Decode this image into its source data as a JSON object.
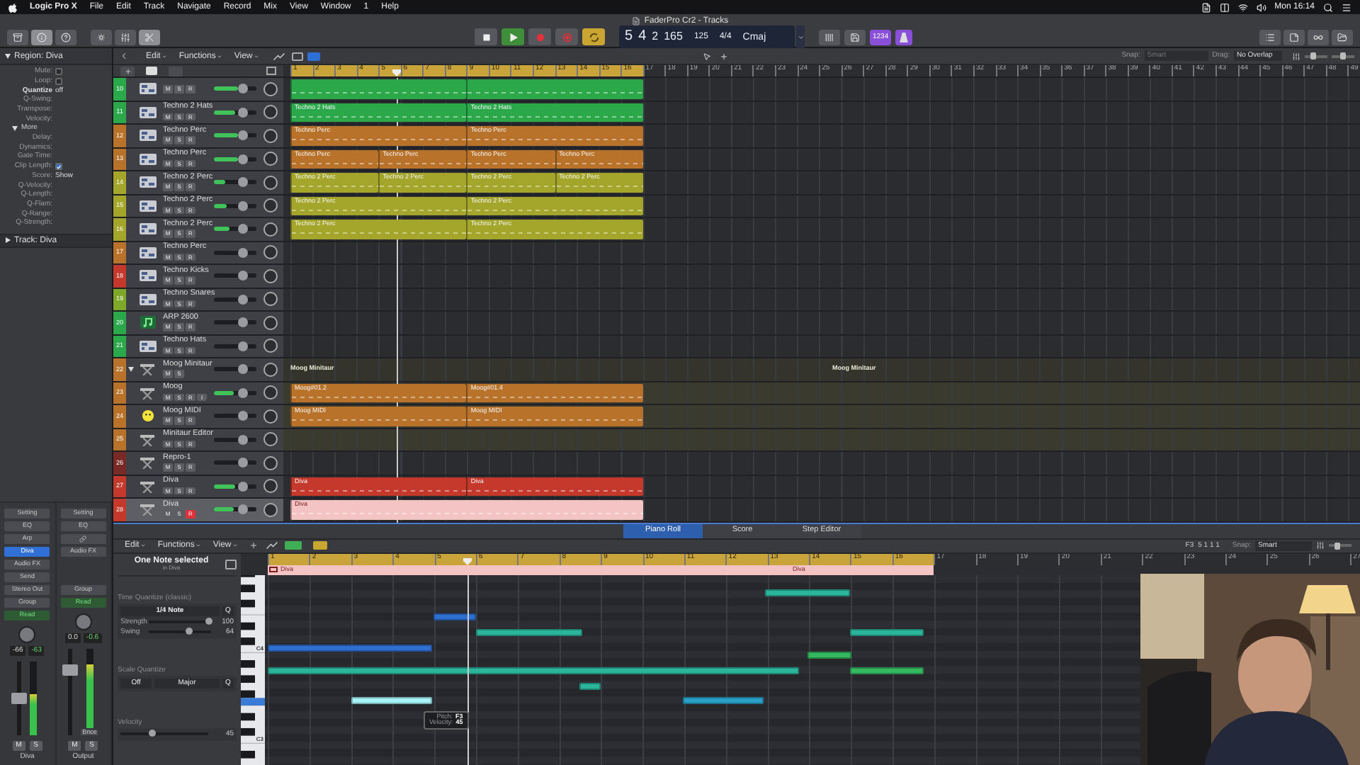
{
  "menu_bar": {
    "app": "Logic Pro X",
    "items": [
      "File",
      "Edit",
      "Track",
      "Navigate",
      "Record",
      "Mix",
      "View",
      "Window",
      "1",
      "Help"
    ],
    "clock": "Mon 16:14"
  },
  "window": {
    "title": "FaderPro Cr2 - Tracks"
  },
  "transport": {
    "buttons": [
      {
        "kind": "stop",
        "on": false
      },
      {
        "kind": "play",
        "on": true
      },
      {
        "kind": "record",
        "on": false
      },
      {
        "kind": "capture",
        "on": false
      },
      {
        "kind": "cycle",
        "on": true
      }
    ],
    "lcd": {
      "bar": "5",
      "beat": "4",
      "div": "2",
      "tick": "165",
      "tempo": "125",
      "signature": "4/4",
      "key": "Cmaj"
    },
    "count_in": {
      "label": "1234",
      "on": true
    },
    "metronome": {
      "on": true
    }
  },
  "inspector": {
    "region": {
      "title": "Region: Diva",
      "expanded": true
    },
    "params": [
      {
        "kind": "checkbox",
        "label": "Mute:",
        "checked": false
      },
      {
        "kind": "checkbox",
        "label": "Loop:",
        "checked": false
      },
      {
        "kind": "value",
        "label": "Quantize",
        "value": "off"
      },
      {
        "kind": "plain",
        "label": "Q-Swing:"
      },
      {
        "kind": "plain",
        "label": "Transpose:"
      },
      {
        "kind": "plain",
        "label": "Velocity:"
      },
      {
        "kind": "section",
        "label": "More",
        "expanded": true
      },
      {
        "kind": "plain",
        "label": "Delay:"
      },
      {
        "kind": "plain",
        "label": "Dynamics:"
      },
      {
        "kind": "plain",
        "label": "Gate Time:"
      },
      {
        "kind": "checkbox",
        "label": "Clip Length:",
        "checked": true
      },
      {
        "kind": "value",
        "label": "Score:",
        "value": "Show"
      },
      {
        "kind": "plain",
        "label": "Q-Velocity:"
      },
      {
        "kind": "plain",
        "label": "Q-Length:"
      },
      {
        "kind": "plain",
        "label": "Q-Flam:"
      },
      {
        "kind": "plain",
        "label": "Q-Range:"
      },
      {
        "kind": "plain",
        "label": "Q-Strength:"
      }
    ],
    "track": {
      "title": "Track: Diva",
      "expanded": false
    },
    "strips": [
      {
        "name": "Diva",
        "slots": [
          {
            "kind": "button",
            "label": "Setting"
          },
          {
            "kind": "button",
            "label": "EQ"
          },
          {
            "kind": "button",
            "label": "Arp"
          },
          {
            "kind": "plugin",
            "label": "Diva"
          },
          {
            "kind": "button",
            "label": "Audio FX"
          },
          {
            "kind": "button",
            "label": "Send"
          },
          {
            "kind": "button",
            "label": "Stereo Out"
          },
          {
            "kind": "button",
            "label": "Group"
          },
          {
            "kind": "automation",
            "label": "Read"
          }
        ],
        "values": [
          "-66",
          "-63"
        ],
        "fader": {
          "level": 0.5
        },
        "meter": {
          "level": 0.55
        },
        "buttons": [
          "M",
          "S"
        ]
      },
      {
        "name": "Output",
        "slots": [
          {
            "kind": "button",
            "label": "Setting"
          },
          {
            "kind": "button",
            "label": "EQ"
          },
          {
            "kind": "link"
          },
          {
            "kind": "button",
            "label": "Audio FX"
          },
          {
            "kind": "empty"
          },
          {
            "kind": "empty"
          },
          {
            "kind": "button",
            "label": "Group"
          },
          {
            "kind": "automation",
            "label": "Read"
          }
        ],
        "values": [
          "0.0",
          "-0.6"
        ],
        "fader": {
          "level": 0.75
        },
        "meter": {
          "level": 0.8
        },
        "bounce": "Bnce",
        "buttons": [
          "M",
          "S"
        ]
      }
    ]
  },
  "tracks_toolbar": {
    "menus": [
      "Edit",
      "Functions",
      "View"
    ],
    "snap_label": "Snap:",
    "snap_value": "Smart",
    "drag_label": "Drag:",
    "drag_value": "No Overlap",
    "zoom_sliders": [
      {
        "level": 0.4
      },
      {
        "level": 0.5
      }
    ]
  },
  "ruler": [
    {
      "label": "1",
      "cycle": true
    },
    {
      "label": "2",
      "cycle": true
    },
    {
      "label": "3",
      "cycle": true
    },
    {
      "label": "4",
      "cycle": true
    },
    {
      "label": "5",
      "cycle": true
    },
    {
      "label": "6",
      "cycle": true
    },
    {
      "label": "7",
      "cycle": true
    },
    {
      "label": "8",
      "cycle": true
    },
    {
      "label": "9",
      "cycle": true
    },
    {
      "label": "10",
      "cycle": true
    },
    {
      "label": "11",
      "cycle": true
    },
    {
      "label": "12",
      "cycle": true
    },
    {
      "label": "13",
      "cycle": true
    },
    {
      "label": "14",
      "cycle": true
    },
    {
      "label": "15",
      "cycle": true
    },
    {
      "label": "16",
      "cycle": true
    },
    {
      "label": "17",
      "cycle": false
    },
    {
      "label": "18",
      "cycle": false
    },
    {
      "label": "19",
      "cycle": false
    },
    {
      "label": "20",
      "cycle": false
    },
    {
      "label": "21",
      "cycle": false
    },
    {
      "label": "22",
      "cycle": false
    },
    {
      "label": "23",
      "cycle": false
    },
    {
      "label": "24",
      "cycle": false
    },
    {
      "label": "25",
      "cycle": false
    },
    {
      "label": "26",
      "cycle": false
    },
    {
      "label": "27",
      "cycle": false
    },
    {
      "label": "28",
      "cycle": false
    },
    {
      "label": "29",
      "cycle": false
    },
    {
      "label": "30",
      "cycle": false
    },
    {
      "label": "31",
      "cycle": false
    },
    {
      "label": "32",
      "cycle": false
    },
    {
      "label": "33",
      "cycle": false
    },
    {
      "label": "34",
      "cycle": false
    },
    {
      "label": "35",
      "cycle": false
    },
    {
      "label": "36",
      "cycle": false
    },
    {
      "label": "37",
      "cycle": false
    },
    {
      "label": "38",
      "cycle": false
    },
    {
      "label": "39",
      "cycle": false
    },
    {
      "label": "40",
      "cycle": false
    },
    {
      "label": "41",
      "cycle": false
    },
    {
      "label": "42",
      "cycle": false
    },
    {
      "label": "43",
      "cycle": false
    },
    {
      "label": "44",
      "cycle": false
    },
    {
      "label": "45",
      "cycle": false
    },
    {
      "label": "46",
      "cycle": false
    },
    {
      "label": "47",
      "cycle": false
    },
    {
      "label": "48",
      "cycle": false
    },
    {
      "label": "49",
      "cycle": false
    }
  ],
  "tracks": [
    {
      "kind": "drum",
      "number": "10",
      "color": "#2aa84a",
      "buttons": [
        "M",
        "S",
        "R"
      ],
      "armed": false,
      "level": 0.55,
      "selected": false,
      "regions": [
        {
          "selected": false
        },
        {
          "selected": false
        }
      ]
    },
    {
      "kind": "drum",
      "number": "11",
      "name": "Techno 2 Hats",
      "color": "#2aa84a",
      "buttons": [
        "M",
        "S",
        "R"
      ],
      "armed": false,
      "level": 0.5,
      "selected": false,
      "regions": [
        {
          "name": "Techno 2 Hats",
          "selected": false
        },
        {
          "name": "Techno 2 Hats",
          "selected": false
        }
      ]
    },
    {
      "kind": "drum",
      "number": "12",
      "name": "Techno Perc",
      "color": "#b8722a",
      "buttons": [
        "M",
        "S",
        "R"
      ],
      "armed": false,
      "level": 0.55,
      "selected": false,
      "regions": [
        {
          "name": "Techno Perc",
          "selected": false
        },
        {
          "name": "Techno Perc",
          "selected": false
        }
      ]
    },
    {
      "kind": "drum",
      "number": "13",
      "name": "Techno Perc",
      "color": "#b8722a",
      "buttons": [
        "M",
        "S",
        "R"
      ],
      "armed": false,
      "level": 0.55,
      "selected": false,
      "regions": [
        {
          "name": "Techno Perc",
          "selected": false
        },
        {
          "name": "Techno Perc",
          "selected": false
        },
        {
          "name": "Techno Perc",
          "selected": false
        },
        {
          "name": "Techno Perc",
          "selected": false
        }
      ]
    },
    {
      "kind": "drum",
      "number": "14",
      "name": "Techno 2 Perc",
      "color": "#a3a62a",
      "buttons": [
        "M",
        "S",
        "R"
      ],
      "armed": false,
      "level": 0.25,
      "selected": false,
      "regions": [
        {
          "name": "Techno 2 Perc",
          "selected": false
        },
        {
          "name": "Techno 2 Perc",
          "selected": false
        },
        {
          "name": "Techno 2 Perc",
          "selected": false
        },
        {
          "name": "Techno 2 Perc",
          "selected": false
        }
      ]
    },
    {
      "kind": "drum",
      "number": "15",
      "name": "Techno 2 Perc",
      "color": "#a3a62a",
      "buttons": [
        "M",
        "S",
        "R"
      ],
      "armed": false,
      "level": 0.3,
      "selected": false,
      "regions": [
        {
          "name": "Techno 2 Perc",
          "selected": false
        },
        {
          "name": "Techno 2 Perc",
          "selected": false
        }
      ]
    },
    {
      "kind": "drum",
      "number": "16",
      "name": "Techno 2 Perc",
      "color": "#a3a62a",
      "buttons": [
        "M",
        "S",
        "R"
      ],
      "armed": false,
      "level": 0.35,
      "selected": false,
      "regions": [
        {
          "name": "Techno 2 Perc",
          "selected": false
        },
        {
          "name": "Techno 2 Perc",
          "selected": false
        }
      ]
    },
    {
      "kind": "drum",
      "number": "17",
      "name": "Techno Perc",
      "color": "#b8722a",
      "buttons": [
        "M",
        "S",
        "R"
      ],
      "armed": false,
      "level": 0,
      "selected": false
    },
    {
      "kind": "drum",
      "number": "18",
      "name": "Techno Kicks",
      "color": "#c4392b",
      "buttons": [
        "M",
        "S",
        "R"
      ],
      "armed": false,
      "level": 0,
      "selected": false
    },
    {
      "kind": "drum",
      "number": "19",
      "name": "Techno Snares",
      "color": "#7ea82a",
      "buttons": [
        "M",
        "S",
        "R"
      ],
      "armed": false,
      "level": 0,
      "selected": false
    },
    {
      "kind": "note",
      "number": "20",
      "name": "ARP 2600",
      "color": "#2aa84a",
      "buttons": [
        "M",
        "S",
        "R"
      ],
      "armed": false,
      "level": 0,
      "selected": false
    },
    {
      "kind": "drum",
      "number": "21",
      "name": "Techno Hats",
      "color": "#2aa84a",
      "buttons": [
        "M",
        "S",
        "R"
      ],
      "armed": false,
      "level": 0,
      "selected": false
    },
    {
      "kind": "synth",
      "number": "22",
      "name": "Moog Minitaur",
      "color": "#b8722a",
      "buttons": [
        "M",
        "S"
      ],
      "level": 0,
      "selected": false,
      "expanded": true,
      "lane_labels": [
        {
          "text": "Moog Minitaur"
        },
        {
          "text": "Moog Minitaur"
        }
      ],
      "children": [
        {
          "kind": "synth",
          "number": "23",
          "name": "Moog",
          "color": "#b8722a",
          "buttons": [
            "M",
            "S",
            "R",
            "I"
          ],
          "armed": false,
          "level": 0.45,
          "selected": false,
          "regions": [
            {
              "name": "Moog#01.2",
              "selected": false
            },
            {
              "name": "Moog#01.4",
              "selected": false
            }
          ]
        },
        {
          "kind": "smiley",
          "number": "24",
          "name": "Moog MIDI",
          "color": "#b8722a",
          "buttons": [
            "M",
            "S",
            "R"
          ],
          "armed": false,
          "level": 0,
          "selected": false,
          "regions": [
            {
              "name": "Moog MIDI",
              "selected": false
            },
            {
              "name": "Moog MIDI",
              "selected": false
            }
          ]
        },
        {
          "kind": "synth",
          "number": "25",
          "name": "Minitaur Editor",
          "color": "#b8722a",
          "buttons": [
            "M",
            "S",
            "R"
          ],
          "armed": false,
          "level": 0,
          "selected": false
        }
      ]
    },
    {
      "kind": "synth",
      "number": "26",
      "name": "Repro-1",
      "color": "#7a2a26",
      "buttons": [
        "M",
        "S",
        "R"
      ],
      "armed": false,
      "level": 0,
      "selected": false
    },
    {
      "kind": "synth",
      "number": "27",
      "name": "Diva",
      "color": "#c4392b",
      "buttons": [
        "M",
        "S",
        "R"
      ],
      "armed": false,
      "level": 0.5,
      "selected": false,
      "regions": [
        {
          "name": "Diva",
          "selected": false
        },
        {
          "name": "Diva",
          "selected": false
        }
      ]
    },
    {
      "kind": "synth",
      "number": "28",
      "name": "Diva",
      "color": "#c4392b",
      "buttons": [
        "M",
        "S",
        "R"
      ],
      "armed": true,
      "level": 0.45,
      "selected": true,
      "regions": [
        {
          "name": "Diva",
          "selected": true
        }
      ]
    }
  ],
  "editor": {
    "tabs": [
      {
        "label": "Piano Roll",
        "selected": true
      },
      {
        "label": "Score",
        "selected": false
      },
      {
        "label": "Step Editor",
        "selected": false
      }
    ],
    "menus": [
      "Edit",
      "Functions",
      "View"
    ],
    "pitch": "F3",
    "position": "5 1 1 1",
    "snap_label": "Snap:",
    "snap_value": "Smart",
    "zoom": {
      "level": 0.4
    },
    "selection": "One Note selected",
    "selection_region": "in Diva",
    "time_quantize": {
      "title": "Time Quantize (classic)",
      "value": "1/4 Note",
      "q": "Q",
      "strength": {
        "label": "Strength",
        "value": "100",
        "level": 0.95
      },
      "swing": {
        "label": "Swing",
        "value": "64",
        "level": 0.64
      }
    },
    "scale_quantize": {
      "title": "Scale Quantize",
      "mode": "Off",
      "scale": "Major",
      "q": "Q"
    },
    "velocity": {
      "label": "Velocity",
      "value": "45",
      "level": 0.35
    },
    "key_labels": [
      "C4",
      "C3"
    ],
    "ruler": [
      {
        "label": "1",
        "cycle": true
      },
      {
        "label": "2",
        "cycle": true
      },
      {
        "label": "3",
        "cycle": true
      },
      {
        "label": "4",
        "cycle": true
      },
      {
        "label": "5",
        "cycle": true
      },
      {
        "label": "6",
        "cycle": true
      },
      {
        "label": "7",
        "cycle": true
      },
      {
        "label": "8",
        "cycle": true
      },
      {
        "label": "9",
        "cycle": true
      },
      {
        "label": "10",
        "cycle": true
      },
      {
        "label": "11",
        "cycle": true
      },
      {
        "label": "12",
        "cycle": true
      },
      {
        "label": "13",
        "cycle": true
      },
      {
        "label": "14",
        "cycle": true
      },
      {
        "label": "15",
        "cycle": true
      },
      {
        "label": "16",
        "cycle": true
      },
      {
        "label": "17",
        "cycle": false
      },
      {
        "label": "18",
        "cycle": false
      },
      {
        "label": "19",
        "cycle": false
      },
      {
        "label": "20",
        "cycle": false
      },
      {
        "label": "21",
        "cycle": false
      },
      {
        "label": "22",
        "cycle": false
      },
      {
        "label": "23",
        "cycle": false
      },
      {
        "label": "24",
        "cycle": false
      },
      {
        "label": "25",
        "cycle": false
      },
      {
        "label": "26",
        "cycle": false
      },
      {
        "label": "27",
        "cycle": false
      }
    ],
    "region_labels": [
      "Diva",
      "Diva"
    ],
    "tooltip": {
      "pitch_label": "Pitch:",
      "pitch": "F3",
      "velocity_label": "Velocity:",
      "velocity": "45"
    }
  }
}
